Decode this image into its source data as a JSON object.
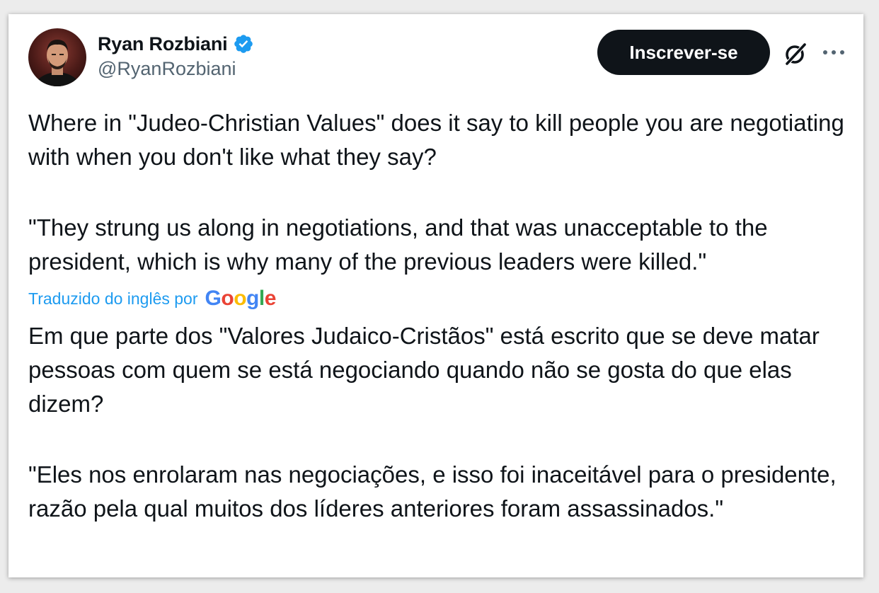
{
  "author": {
    "name": "Ryan Rozbiani",
    "handle": "@RyanRozbiani",
    "verified": true
  },
  "actions": {
    "subscribe_label": "Inscrever-se",
    "grok_icon": "grok-icon",
    "more_icon": "more-icon"
  },
  "tweet": {
    "original_paragraph_1": "Where in \"Judeo-Christian Values\" does it say to kill people you are negotiating with when you don't like what they say?",
    "original_paragraph_2": "\"They strung us along in negotiations, and that was unacceptable to the president, which is why many of the previous leaders were killed.\"",
    "translation_label": "Traduzido do inglês por",
    "translation_provider": "Google",
    "translated_paragraph_1": "Em que parte dos \"Valores Judaico-Cristãos\" está escrito que se deve matar pessoas com quem se está negociando quando não se gosta do que elas dizem?",
    "translated_paragraph_2": "\"Eles nos enrolaram nas negociações, e isso foi inaceitável para o presidente, razão pela qual muitos dos líderes anteriores foram assassinados.\""
  },
  "colors": {
    "verified_badge": "#1d9bf0",
    "link": "#1d9bf0",
    "button_bg": "#0f1419",
    "text": "#0f1419",
    "secondary_text": "#536471",
    "google_blue": "#4285f4",
    "google_red": "#ea4335",
    "google_yellow": "#fbbc05",
    "google_green": "#34a853"
  }
}
